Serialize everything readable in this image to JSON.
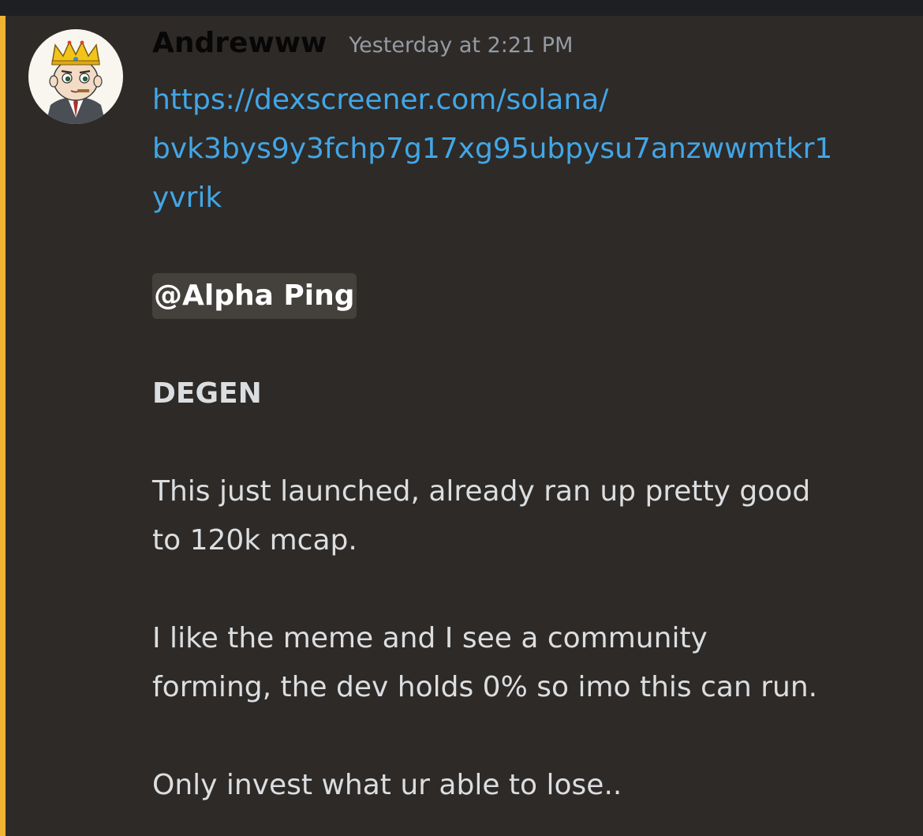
{
  "message": {
    "author": "Andrewww",
    "timestamp": "Yesterday at 2:21 PM",
    "link_lines": [
      "https://dexscreener.com/solana/",
      "bvk3bys9y3fchp7g17xg95ubpysu7anzwwmtkr1",
      "yvrik"
    ],
    "mention": "@Alpha Ping",
    "heading": "DEGEN",
    "paragraphs": [
      [
        "This just launched, already ran up pretty good",
        "to 120k mcap."
      ],
      [
        "I like the meme and I see a community",
        "forming, the dev holds 0% so imo this can run."
      ],
      [
        "Only invest what ur able to lose.."
      ]
    ]
  },
  "colors": {
    "background": "#2e2a27",
    "accent_bar": "#f0b232",
    "link": "#42a6e6",
    "timestamp": "#949ba4",
    "text": "#dbdee1",
    "mention_bg": "#44403c"
  },
  "icons": {
    "avatar": "crowned-cartoon-businessman-avatar"
  }
}
